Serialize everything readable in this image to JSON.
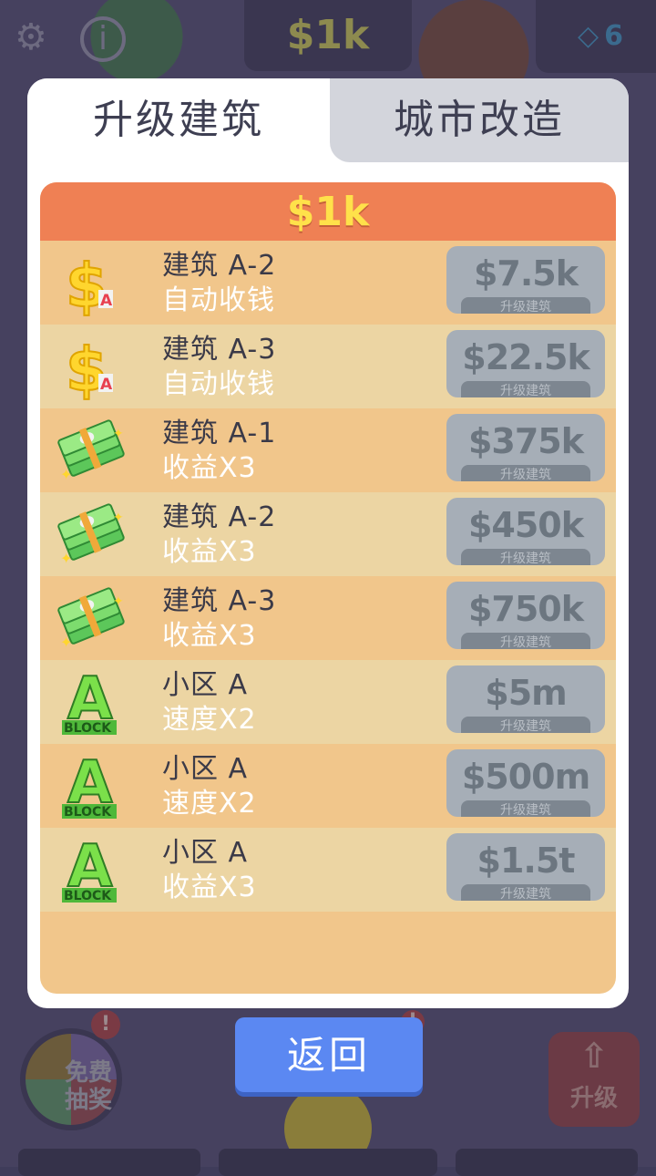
{
  "hud": {
    "money": "$1k",
    "gems": "6"
  },
  "background": {
    "wheel_label": "免费抽奖",
    "upgrade_label": "升级",
    "badge": "!"
  },
  "tabs": {
    "active": "升级建筑",
    "inactive": "城市改造"
  },
  "panel": {
    "header_money": "$1k"
  },
  "upgrades": [
    {
      "icon": "dollar-a-icon",
      "title": "建筑 A-2",
      "subtitle": "自动收钱",
      "price": "$7.5k",
      "button_label": "升级建筑"
    },
    {
      "icon": "dollar-a-icon",
      "title": "建筑 A-3",
      "subtitle": "自动收钱",
      "price": "$22.5k",
      "button_label": "升级建筑"
    },
    {
      "icon": "cash-stack-icon",
      "title": "建筑 A-1",
      "subtitle": "收益X3",
      "price": "$375k",
      "button_label": "升级建筑"
    },
    {
      "icon": "cash-stack-icon",
      "title": "建筑 A-2",
      "subtitle": "收益X3",
      "price": "$450k",
      "button_label": "升级建筑"
    },
    {
      "icon": "cash-stack-icon",
      "title": "建筑 A-3",
      "subtitle": "收益X3",
      "price": "$750k",
      "button_label": "升级建筑"
    },
    {
      "icon": "a-block-icon",
      "title": "小区 A",
      "subtitle": "速度X2",
      "price": "$5m",
      "button_label": "升级建筑"
    },
    {
      "icon": "a-block-icon",
      "title": "小区 A",
      "subtitle": "速度X2",
      "price": "$500m",
      "button_label": "升级建筑"
    },
    {
      "icon": "a-block-icon",
      "title": "小区 A",
      "subtitle": "收益X3",
      "price": "$1.5t",
      "button_label": "升级建筑"
    }
  ],
  "back_button": "返回"
}
